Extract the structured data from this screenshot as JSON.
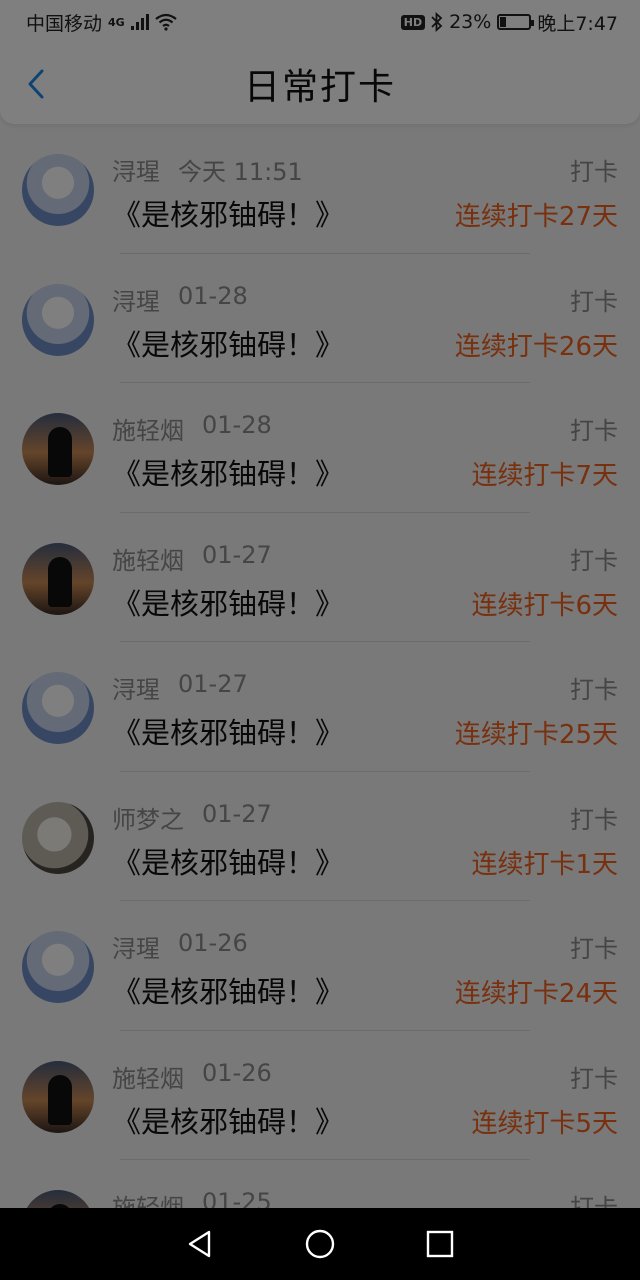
{
  "status": {
    "carrier": "中国移动",
    "network": "4G",
    "battery_percent_text": "23%",
    "battery_level": 0.23,
    "time": "晚上7:47"
  },
  "header": {
    "title": "日常打卡"
  },
  "checkins": [
    {
      "name": "浔瑆",
      "date": "今天 11:51",
      "content": "《是核邪铀碍！》",
      "type": "打卡",
      "streak": "连续打卡27天",
      "avatar": "girl-avatar"
    },
    {
      "name": "浔瑆",
      "date": "01-28",
      "content": "《是核邪铀碍！》",
      "type": "打卡",
      "streak": "连续打卡26天",
      "avatar": "girl-avatar"
    },
    {
      "name": "施轻烟",
      "date": "01-28",
      "content": "《是核邪铀碍！》",
      "type": "打卡",
      "streak": "连续打卡7天",
      "avatar": "sunset-avatar"
    },
    {
      "name": "施轻烟",
      "date": "01-27",
      "content": "《是核邪铀碍！》",
      "type": "打卡",
      "streak": "连续打卡6天",
      "avatar": "sunset-avatar"
    },
    {
      "name": "浔瑆",
      "date": "01-27",
      "content": "《是核邪铀碍！》",
      "type": "打卡",
      "streak": "连续打卡25天",
      "avatar": "girl-avatar"
    },
    {
      "name": "师梦之",
      "date": "01-27",
      "content": "《是核邪铀碍！》",
      "type": "打卡",
      "streak": "连续打卡1天",
      "avatar": "cat-avatar"
    },
    {
      "name": "浔瑆",
      "date": "01-26",
      "content": "《是核邪铀碍！》",
      "type": "打卡",
      "streak": "连续打卡24天",
      "avatar": "girl-avatar"
    },
    {
      "name": "施轻烟",
      "date": "01-26",
      "content": "《是核邪铀碍！》",
      "type": "打卡",
      "streak": "连续打卡5天",
      "avatar": "sunset-avatar"
    },
    {
      "name": "施轻烟",
      "date": "01-25",
      "content": "",
      "type": "打卡",
      "streak": "",
      "avatar": "sunset-avatar"
    }
  ],
  "colors": {
    "accent": "#1e88e5",
    "streak": "#f0601c"
  }
}
